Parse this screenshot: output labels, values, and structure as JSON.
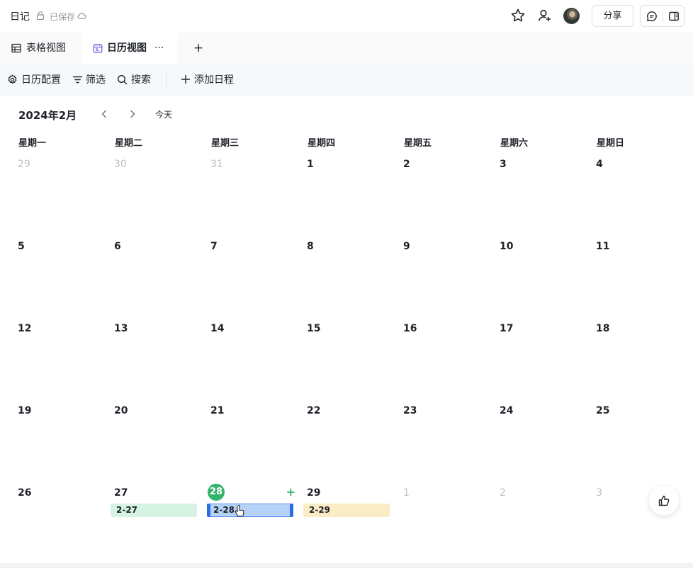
{
  "header": {
    "doc_title": "日记",
    "save_status": "已保存",
    "share_label": "分享"
  },
  "tabs": [
    {
      "label": "表格视图",
      "active": false
    },
    {
      "label": "日历视图",
      "active": true,
      "more": "···"
    }
  ],
  "add_tab_label": "+",
  "toolbar": {
    "calendar_config": "日历配置",
    "filter": "筛选",
    "search": "搜索",
    "add_event": "添加日程"
  },
  "calendar": {
    "month_label": "2024年2月",
    "today_label": "今天",
    "weekdays": [
      "星期一",
      "星期二",
      "星期三",
      "星期四",
      "星期五",
      "星期六",
      "星期日"
    ],
    "weeks": [
      [
        {
          "d": "29",
          "other": true
        },
        {
          "d": "30",
          "other": true
        },
        {
          "d": "31",
          "other": true
        },
        {
          "d": "1"
        },
        {
          "d": "2"
        },
        {
          "d": "3"
        },
        {
          "d": "4"
        }
      ],
      [
        {
          "d": "5"
        },
        {
          "d": "6"
        },
        {
          "d": "7"
        },
        {
          "d": "8"
        },
        {
          "d": "9"
        },
        {
          "d": "10"
        },
        {
          "d": "11"
        }
      ],
      [
        {
          "d": "12"
        },
        {
          "d": "13"
        },
        {
          "d": "14"
        },
        {
          "d": "15"
        },
        {
          "d": "16"
        },
        {
          "d": "17"
        },
        {
          "d": "18"
        }
      ],
      [
        {
          "d": "19"
        },
        {
          "d": "20"
        },
        {
          "d": "21"
        },
        {
          "d": "22"
        },
        {
          "d": "23"
        },
        {
          "d": "24"
        },
        {
          "d": "25"
        }
      ],
      [
        {
          "d": "26"
        },
        {
          "d": "27",
          "event": {
            "label": "2-27",
            "color": "green"
          }
        },
        {
          "d": "28",
          "today": true,
          "add": "+",
          "event": {
            "label": "2-28",
            "color": "blue",
            "selected": true
          }
        },
        {
          "d": "29",
          "event": {
            "label": "2-29",
            "color": "yellow"
          }
        },
        {
          "d": "1",
          "other": true
        },
        {
          "d": "2",
          "other": true
        },
        {
          "d": "3",
          "other": true
        }
      ]
    ]
  },
  "colors": {
    "accent_green": "#34b36b",
    "event_green": "#d7f3e4",
    "event_blue": "#b6d2f7",
    "event_yellow": "#faecc4",
    "selection_blue": "#2a6ee6"
  }
}
